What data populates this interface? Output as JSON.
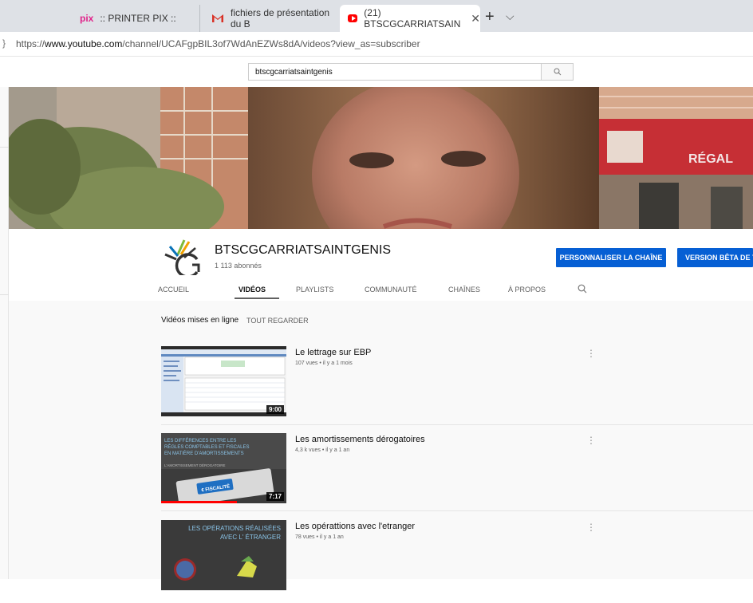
{
  "browser": {
    "tabs": [
      {
        "icon_text": "pix",
        "label": ":: PRINTER PIX ::"
      },
      {
        "label": "fichiers de présentation du B"
      },
      {
        "label": "(21) BTSCGCARRIATSAIN"
      }
    ],
    "tab_close": "✕",
    "new_tab": "+",
    "tab_menu": "⌵",
    "reload_glyph": "}",
    "url_prefix": "https://",
    "url_host": "www.youtube.com",
    "url_path": "/channel/UCAFgpBIL3of7WdAnEZWs8dA/videos?view_as=subscriber"
  },
  "search": {
    "query": "btscgcarriatsaintgenis"
  },
  "channel": {
    "name": "BTSCGCARRIATSAINTGENIS",
    "subscribers": "1 113 abonnés",
    "customize_button": "PERSONNALISER LA CHAÎNE",
    "beta_button": "VERSION BÊTA DE YO",
    "banner_sign": "RÉGAL"
  },
  "nav": {
    "tabs": [
      "ACCUEIL",
      "VIDÉOS",
      "PLAYLISTS",
      "COMMUNAUTÉ",
      "CHAÎNES",
      "À PROPOS"
    ],
    "active": "VIDÉOS"
  },
  "shelf": {
    "title": "Vidéos mises en ligne",
    "play_all": "TOUT REGARDER"
  },
  "videos": [
    {
      "title": "Le lettrage sur EBP",
      "meta": "107 vues • il y a 1 mois",
      "duration": "9:00"
    },
    {
      "title": "Les amortissements dérogatoires",
      "meta": "4,3 k vues • il y a 1 an",
      "duration": "7:17",
      "thumb_lines": [
        "LES DIFFÉRENCES ENTRE LES",
        "RÈGLES COMPTABLES ET FISCALES",
        "EN MATIÈRE D'AMORTISSEMENTS"
      ],
      "thumb_sub": "L'AMORTISSEMENT DÉROGATOIRE",
      "thumb_key": "€ FISCALITÉ"
    },
    {
      "title": "Les opérattions avec l'etranger",
      "meta": "78 vues • il y a 1 an",
      "thumb_lines": [
        "LES OPÉRATIONS RÉALISÉES",
        "AVEC L' ÉTRANGER"
      ]
    }
  ],
  "kebab": "⋮",
  "colors": {
    "accent": "#065fd4",
    "tabbar": "#dee1e6",
    "youtube_red": "#ff0000",
    "pix_pink": "#e0238a"
  }
}
